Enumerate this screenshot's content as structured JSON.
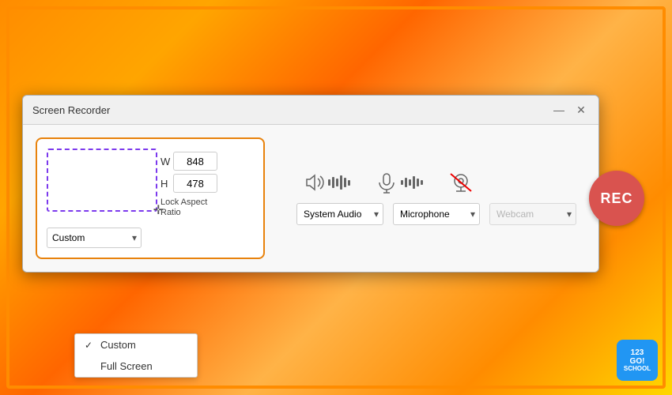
{
  "background": {
    "color": "#5cb85c"
  },
  "dialog": {
    "title": "Screen Recorder",
    "minimize_label": "—",
    "close_label": "✕"
  },
  "recording_area": {
    "width_label": "W",
    "height_label": "H",
    "width_value": "848",
    "height_value": "478",
    "lock_aspect_label": "Lock Aspect\nRatio",
    "preset_value": "Custom",
    "preset_options": [
      "Custom",
      "Full Screen"
    ]
  },
  "dropdown": {
    "items": [
      {
        "label": "Custom",
        "selected": true
      },
      {
        "label": "Full Screen",
        "selected": false
      }
    ]
  },
  "audio": {
    "system_audio_label": "System Audio",
    "microphone_label": "Microphone",
    "webcam_label": "Webcam",
    "system_audio_options": [
      "System Audio"
    ],
    "microphone_options": [
      "Microphone"
    ],
    "webcam_options": [
      "Webcam"
    ]
  },
  "rec_button": {
    "label": "REC"
  },
  "logo": {
    "line1": "123",
    "line2": "GO!",
    "line3": "SCHOOL"
  }
}
